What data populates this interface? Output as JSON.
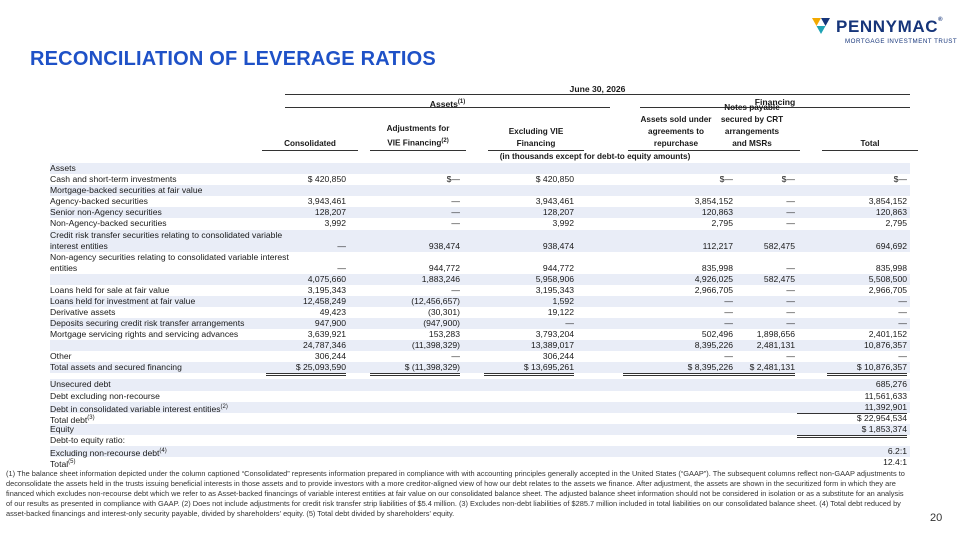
{
  "brand": {
    "name": "PENNYMAC",
    "mark": "®",
    "tagline": "MORTGAGE INVESTMENT TRUST"
  },
  "title": "RECONCILIATION OF LEVERAGE RATIOS",
  "table": {
    "date": "June 30, 2026",
    "group_assets": "Assets",
    "group_assets_sup": "(1)",
    "group_financing": "Financing",
    "units": "(in thousands except for debt-to equity amounts)",
    "columns": [
      {
        "lines": [
          "Consolidated"
        ]
      },
      {
        "lines": [
          "Adjustments for",
          "VIE Financing"
        ],
        "sup": "(2)"
      },
      {
        "lines": [
          "Excluding VIE",
          "Financing"
        ]
      },
      {
        "lines": [
          "Assets sold under",
          "agreements to",
          "repurchase"
        ]
      },
      {
        "lines": [
          "Notes payable",
          "secured by CRT",
          "arrangements",
          "and MSRs"
        ]
      },
      {
        "lines": [
          "Total"
        ]
      }
    ],
    "rows": [
      {
        "label": "Assets",
        "values": [
          "",
          "",
          "",
          "",
          "",
          ""
        ]
      },
      {
        "label": "Cash and short-term investments",
        "values": [
          "$ 420,850",
          "$—",
          "$ 420,850",
          "$—",
          "$—",
          "$—"
        ]
      },
      {
        "label": "Mortgage-backed securities at fair value",
        "values": [
          "",
          "",
          "",
          "",
          "",
          ""
        ]
      },
      {
        "label": "Agency-backed securities",
        "values": [
          "3,943,461",
          "—",
          "3,943,461",
          "3,854,152",
          "—",
          "3,854,152"
        ]
      },
      {
        "label": "Senior non-Agency securities",
        "values": [
          "128,207",
          "—",
          "128,207",
          "120,863",
          "—",
          "120,863"
        ]
      },
      {
        "label": "Non-Agency-backed securities",
        "values": [
          "3,992",
          "—",
          "3,992",
          "2,795",
          "—",
          "2,795"
        ]
      },
      {
        "label": "Credit risk transfer securities relating to consolidated variable interest entities",
        "values": [
          "—",
          "938,474",
          "938,474",
          "112,217",
          "582,475",
          "694,692"
        ]
      },
      {
        "label": "Non-agency securities relating to consolidated variable interest entities",
        "values": [
          "—",
          "944,772",
          "944,772",
          "835,998",
          "—",
          "835,998"
        ]
      },
      {
        "label": "",
        "values": [
          "4,075,660",
          "1,883,246",
          "5,958,906",
          "4,926,025",
          "582,475",
          "5,508,500"
        ]
      },
      {
        "label": "Loans held for sale at fair value",
        "values": [
          "3,195,343",
          "—",
          "3,195,343",
          "2,966,705",
          "—",
          "2,966,705"
        ]
      },
      {
        "label": "Loans held for investment at fair value",
        "values": [
          "12,458,249",
          "(12,456,657)",
          "1,592",
          "—",
          "—",
          "—"
        ]
      },
      {
        "label": "Derivative assets",
        "values": [
          "49,423",
          "(30,301)",
          "19,122",
          "—",
          "—",
          "—"
        ]
      },
      {
        "label": "Deposits securing credit risk transfer arrangements",
        "values": [
          "947,900",
          "(947,900)",
          "—",
          "—",
          "—",
          "—"
        ]
      },
      {
        "label": "Mortgage servicing rights and servicing advances",
        "values": [
          "3,639,921",
          "153,283",
          "3,793,204",
          "502,496",
          "1,898,656",
          "2,401,152"
        ]
      },
      {
        "label": "",
        "values": [
          "24,787,346",
          "(11,398,329)",
          "13,389,017",
          "8,395,226",
          "2,481,131",
          "10,876,357"
        ]
      },
      {
        "label": "Other",
        "values": [
          "306,244",
          "—",
          "306,244",
          "—",
          "—",
          "—"
        ]
      },
      {
        "label": "Total assets and secured financing",
        "values": [
          "$ 25,093,590",
          "$ (11,398,329)",
          "$ 13,695,261",
          "$ 8,395,226",
          "$ 2,481,131",
          "$ 10,876,357"
        ]
      }
    ],
    "debt_rows": [
      {
        "label": "Unsecured debt",
        "sup": "",
        "value": "685,276"
      },
      {
        "label": "Debt excluding non-recourse",
        "sup": "",
        "value": "11,561,633"
      },
      {
        "label": "Debt in consolidated variable interest entities",
        "sup": "(2)",
        "value": "11,392,901"
      },
      {
        "label": "Total debt",
        "sup": "(3)",
        "value": "$ 22,954,534"
      },
      {
        "label": "Equity",
        "sup": "",
        "value": "$ 1,853,374"
      },
      {
        "label": "Debt-to equity ratio:",
        "sup": "",
        "value": ""
      },
      {
        "label": "Excluding non-recourse debt",
        "sup": "(4)",
        "value": "6.2:1"
      },
      {
        "label": "Total",
        "sup": "(5)",
        "value": "12.4:1"
      }
    ]
  },
  "footnote": "(1) The balance sheet information depicted under the column captioned “Consolidated” represents information prepared in compliance with with accounting principles generally accepted in the United States (“GAAP”). The subsequent columns reflect non-GAAP adjustments to deconsolidate the assets held in the trusts issuing beneficial interests in those assets and to provide investors with a more creditor-aligned view of how our debt relates to the assets we finance. After adjustment, the assets are shown in the securitized form in which they are financed which excludes non-recourse debt which we refer to as Asset-backed financings of variable interest entities at fair value on our consolidated balance sheet. The adjusted balance sheet information should not be considered in isolation or as a substitute for an analysis of our results as presented in compliance with GAAP.     (2) Does not include adjustments for credit risk transfer strip liabilities of $5.4 million.     (3) Excludes non-debt liabilities of $285.7 million included in total liabilities on our consolidated balance sheet.     (4) Total debt reduced by asset-backed financings and interest-only security payable, divided by shareholders' equity.     (5) Total debt divided by shareholders' equity.",
  "page_number": "20",
  "colors": {
    "title": "#1e51c7",
    "brand": "#16357a",
    "shade": "#e9edf7",
    "mark_gold": "#f2a900",
    "mark_teal": "#1fa3b5"
  }
}
